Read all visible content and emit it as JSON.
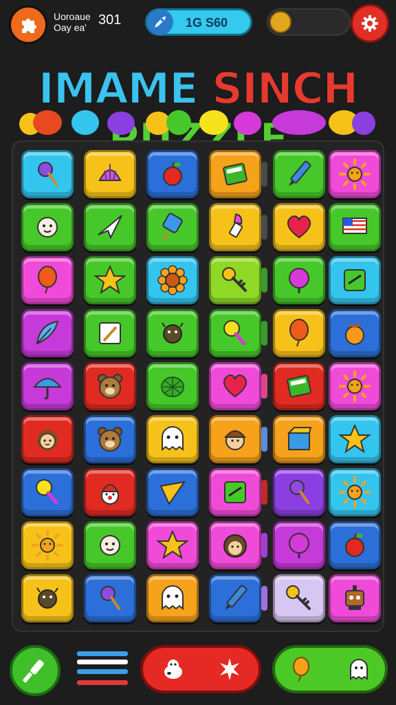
{
  "hud": {
    "line1": "Uoroaue",
    "line2": "Oay ea'",
    "score": "301",
    "speed_value": "1G S60"
  },
  "title": {
    "words": [
      {
        "text": "IMAME",
        "color": "#39c3ee"
      },
      {
        "text": "SINCH",
        "color": "#e63a2e"
      },
      {
        "text": "PUZZLE",
        "color": "#56cf33"
      }
    ]
  },
  "colors": {
    "cyan": "#34c5ee",
    "yellow": "#f6c21a",
    "blue": "#2c6fd8",
    "green": "#47c82a",
    "pink": "#f04bd8",
    "orange": "#f7a21b",
    "magenta": "#c63ad9",
    "red": "#e12b22",
    "purple": "#8c3fe0",
    "lime": "#8fd826",
    "lavender": "#d8c6f2"
  },
  "board": {
    "rows": [
      [
        {
          "color": "cyan",
          "icon": "lollipop-icon"
        },
        {
          "color": "yellow",
          "icon": "shell-icon"
        },
        {
          "color": "blue",
          "icon": "apple-icon"
        },
        {
          "color": "orange",
          "icon": "book-icon"
        },
        {
          "color": "green",
          "icon": "pencil-icon"
        },
        {
          "color": "pink",
          "icon": "sun-icon"
        }
      ],
      [
        {
          "color": "green",
          "icon": "face-icon"
        },
        {
          "color": "green",
          "icon": "paper-plane-icon"
        },
        {
          "color": "green",
          "icon": "popsicle-icon"
        },
        {
          "color": "yellow",
          "icon": "lipstick-icon"
        },
        {
          "color": "yellow",
          "icon": "heart-icon"
        },
        {
          "color": "green",
          "icon": "flag-icon"
        }
      ],
      [
        {
          "color": "pink",
          "icon": "balloon-icon"
        },
        {
          "color": "green",
          "icon": "star-icon"
        },
        {
          "color": "cyan",
          "icon": "sunflower-icon"
        },
        {
          "color": "lime",
          "icon": "key-icon"
        },
        {
          "color": "green",
          "icon": "ball-icon"
        },
        {
          "color": "cyan",
          "icon": "card-icon"
        }
      ],
      [
        {
          "color": "magenta",
          "icon": "feather-icon"
        },
        {
          "color": "green",
          "icon": "note-icon"
        },
        {
          "color": "green",
          "icon": "bug-icon"
        },
        {
          "color": "green",
          "icon": "rattle-icon"
        },
        {
          "color": "yellow",
          "icon": "balloon-icon"
        },
        {
          "color": "blue",
          "icon": "orange-icon"
        }
      ],
      [
        {
          "color": "magenta",
          "icon": "umbrella-icon"
        },
        {
          "color": "red",
          "icon": "bear-icon"
        },
        {
          "color": "green",
          "icon": "turtle-icon"
        },
        {
          "color": "pink",
          "icon": "heart-icon"
        },
        {
          "color": "red",
          "icon": "book-icon"
        },
        {
          "color": "pink",
          "icon": "sun-icon"
        }
      ],
      [
        {
          "color": "red",
          "icon": "girl-icon"
        },
        {
          "color": "blue",
          "icon": "bear-icon"
        },
        {
          "color": "yellow",
          "icon": "ghost-icon"
        },
        {
          "color": "orange",
          "icon": "boy-icon"
        },
        {
          "color": "orange",
          "icon": "box-icon"
        },
        {
          "color": "cyan",
          "icon": "star-icon"
        }
      ],
      [
        {
          "color": "blue",
          "icon": "rattle-icon"
        },
        {
          "color": "red",
          "icon": "clown-icon"
        },
        {
          "color": "blue",
          "icon": "cone-icon"
        },
        {
          "color": "pink",
          "icon": "card-icon"
        },
        {
          "color": "purple",
          "icon": "lollipop-icon"
        },
        {
          "color": "cyan",
          "icon": "sun-icon"
        }
      ],
      [
        {
          "color": "yellow",
          "icon": "sun-icon"
        },
        {
          "color": "green",
          "icon": "face-icon"
        },
        {
          "color": "pink",
          "icon": "star-icon"
        },
        {
          "color": "pink",
          "icon": "hedgehog-icon"
        },
        {
          "color": "magenta",
          "icon": "ball-icon"
        },
        {
          "color": "blue",
          "icon": "apple-icon"
        }
      ],
      [
        {
          "color": "yellow",
          "icon": "bug-icon"
        },
        {
          "color": "blue",
          "icon": "lollipop-icon"
        },
        {
          "color": "orange",
          "icon": "ghost-icon"
        },
        {
          "color": "blue",
          "icon": "pencil-icon"
        },
        {
          "color": "lavender",
          "icon": "key-icon"
        },
        {
          "color": "pink",
          "icon": "robot-icon"
        }
      ]
    ],
    "dividers": [
      "#4a4a4a",
      "#4a4a4a",
      "#3a9a2a",
      "#3a9a2a",
      "#e0428c",
      "#5a8ce0",
      "#c02a2a",
      "#a040d0",
      "#a070e0"
    ]
  },
  "bottom": {
    "bar_colors": [
      "#3aa0e8",
      "#ffffff",
      "#e03a3a"
    ]
  }
}
